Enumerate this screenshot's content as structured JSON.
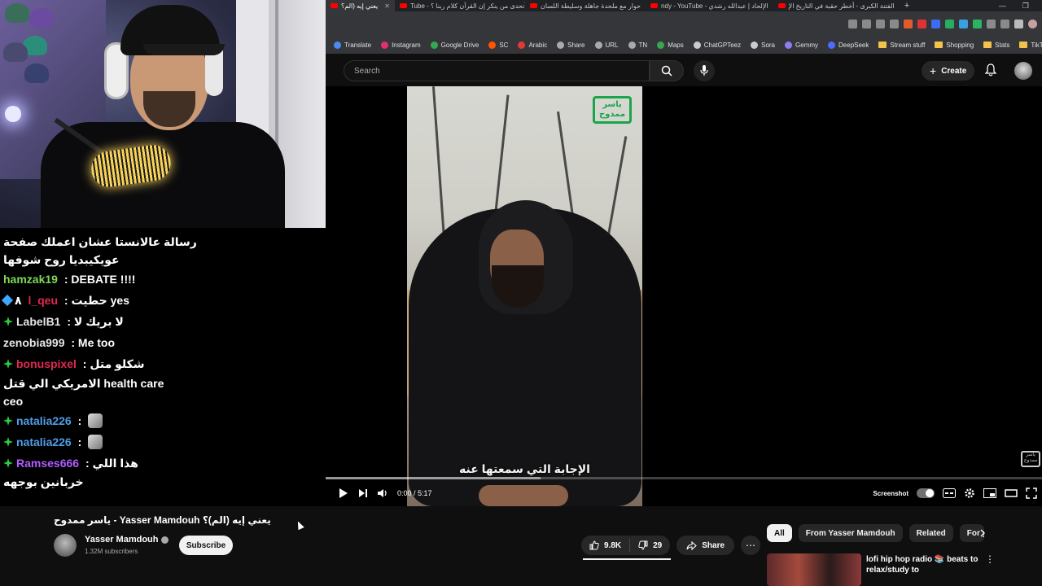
{
  "browser": {
    "tabs": [
      {
        "label": "يعني إيه (الم؟",
        "active": true
      },
      {
        "label": "Tube - أتحدى من ينكر إن القرآن كلام ربنا ؟",
        "active": false
      },
      {
        "label": "حوار مع ملحدة جاهلة وسليطة اللسان",
        "active": false
      },
      {
        "label": "ndy - YouTube - الإلحاد | عبدالله رشدي",
        "active": false
      },
      {
        "label": "الفتنة الكبرى - أخطر حقبة في التاريخ الإ",
        "active": false
      }
    ],
    "bookmarks": [
      {
        "label": "Translate",
        "color": "#4a8af4"
      },
      {
        "label": "Instagram",
        "color": "#e1306c"
      },
      {
        "label": "Google Drive",
        "color": "#34a853"
      },
      {
        "label": "SC",
        "color": "#ff5500"
      },
      {
        "label": "Arabic",
        "color": "#e53935"
      },
      {
        "label": "Share",
        "color": "#aaaaaa"
      },
      {
        "label": "URL",
        "color": "#aaaaaa"
      },
      {
        "label": "TN",
        "color": "#aaaaaa"
      },
      {
        "label": "Maps",
        "color": "#34a853"
      },
      {
        "label": "ChatGPTeez",
        "color": "#cccccc"
      },
      {
        "label": "Sora",
        "color": "#cccccc"
      },
      {
        "label": "Gemmy",
        "color": "#8e7cf0"
      },
      {
        "label": "DeepSeek",
        "color": "#4d6bfe"
      },
      {
        "label": "Stream stuff",
        "color": "folder"
      },
      {
        "label": "Shopping",
        "color": "folder"
      },
      {
        "label": "Stats",
        "color": "folder"
      },
      {
        "label": "TikTok",
        "color": "folder"
      }
    ]
  },
  "header": {
    "search_placeholder": "Search",
    "create_label": "Create"
  },
  "chat": {
    "lines": [
      {
        "parts": [
          {
            "text": "رسالة عالانستا عشان اعملك صفحة",
            "color": "#ffffff"
          }
        ],
        "badge": "none"
      },
      {
        "parts": [
          {
            "text": "عويكيبديا روح شوفها",
            "color": "#ffffff"
          }
        ],
        "badge": "none"
      },
      {
        "parts": [
          {
            "text": "hamzak19",
            "color": "#7ed957"
          },
          {
            "text": " : DEBATE !!!!",
            "color": "#ffffff"
          }
        ],
        "badge": "none"
      },
      {
        "parts": [
          {
            "text": "٨ ",
            "color": "#ffffff"
          },
          {
            "text": "l_qeu",
            "color": "#e0284f"
          },
          {
            "text": " : حطيت yes",
            "color": "#ffffff"
          }
        ],
        "badge": "blue"
      },
      {
        "parts": [
          {
            "text": "LabelB1",
            "color": "#e6e6e6"
          },
          {
            "text": " : لا بريك لا",
            "color": "#ffffff"
          }
        ],
        "badge": "green"
      },
      {
        "parts": [
          {
            "text": "zenobia999",
            "color": "#e6e6e6"
          },
          {
            "text": " : Me too",
            "color": "#ffffff"
          }
        ],
        "badge": "none"
      },
      {
        "parts": [
          {
            "text": "bonuspixel",
            "color": "#e0284f"
          },
          {
            "text": " : شكلو متل",
            "color": "#ffffff"
          }
        ],
        "badge": "green"
      },
      {
        "parts": [
          {
            "text": "الامريكي الي قتل health care",
            "color": "#ffffff"
          }
        ],
        "badge": "none"
      },
      {
        "parts": [
          {
            "text": "ceo",
            "color": "#ffffff"
          }
        ],
        "badge": "none"
      },
      {
        "parts": [
          {
            "text": "natalia226",
            "color": "#4f9ee8"
          },
          {
            "text": " : ",
            "color": "#ffffff"
          }
        ],
        "badge": "green",
        "emote": true
      },
      {
        "parts": [
          {
            "text": "natalia226",
            "color": "#4f9ee8"
          },
          {
            "text": " : ",
            "color": "#ffffff"
          }
        ],
        "badge": "green",
        "emote": true
      },
      {
        "parts": [
          {
            "text": "Ramses666",
            "color": "#b05cff"
          },
          {
            "text": " : هذا اللي",
            "color": "#ffffff"
          }
        ],
        "badge": "green"
      }
    ],
    "last_line": "خربانين بوجهه"
  },
  "video": {
    "subtitle": "الإجابة التي سمعتها عنه",
    "logo_text": "ياسر ممدوح",
    "time_display": "0:00 / 5:17",
    "progress_buffered_fraction": 0.3,
    "screenshot_label": "Screenshot"
  },
  "below": {
    "title": "ياسر ممدوح - Yasser Mamdouh يعني إيه (الم)؟",
    "channel_name": "Yasser Mamdouh",
    "subscribers": "1.32M subscribers",
    "subscribe_label": "Subscribe",
    "likes": "9.8K",
    "dislikes": "29",
    "share_label": "Share",
    "chips": [
      "All",
      "From Yasser Mamdouh",
      "Related",
      "For y"
    ],
    "rec_title": "lofi hip hop radio 📚 beats to relax/study to"
  }
}
